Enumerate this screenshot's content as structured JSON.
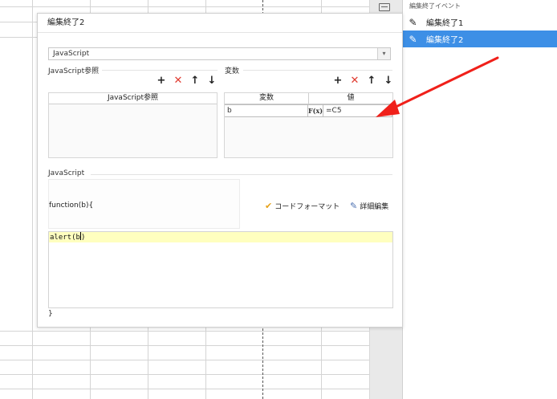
{
  "dialog": {
    "title": "編集終了2",
    "language_select": {
      "value": "JavaScript",
      "arrow": "chevron-down"
    },
    "js_refs": {
      "label": "JavaScript参照",
      "column_header": "JavaScript参照",
      "toolbar": {
        "add": "+",
        "delete": "✕",
        "up": "↑",
        "down": "↓"
      }
    },
    "variables": {
      "label": "変数",
      "toolbar": {
        "add": "+",
        "delete": "✕",
        "up": "↑",
        "down": "↓"
      },
      "columns": {
        "name": "変数",
        "value": "値"
      },
      "rows": [
        {
          "name": "b",
          "fx": "F(x)",
          "value": "=C5"
        }
      ]
    },
    "javascript": {
      "label": "JavaScript",
      "function_signature": "function(b){",
      "format_action": "コードフォーマット",
      "detail_action": "詳細編集",
      "code_before_cursor": "alert(b",
      "code_after_cursor": ")",
      "closing_brace": "}"
    }
  },
  "event_panel": {
    "header": "編集終了イベント",
    "items": [
      {
        "label": "編集終了1",
        "selected": false
      },
      {
        "label": "編集終了2",
        "selected": true
      }
    ]
  },
  "colors": {
    "selected_bg": "#3d8fe6",
    "delete_red": "#e03a2f",
    "annotation_red": "#f0201a",
    "code_highlight": "#ffffbf"
  }
}
